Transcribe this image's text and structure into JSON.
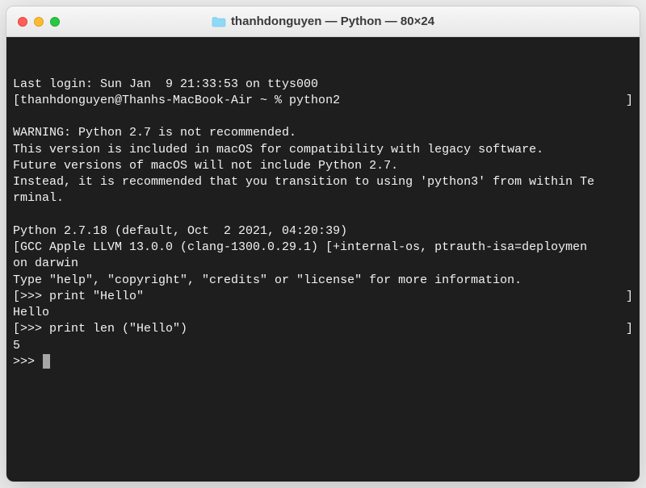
{
  "window": {
    "title": "thanhdonguyen — Python — 80×24"
  },
  "terminal": {
    "lines": [
      {
        "text": "Last login: Sun Jan  9 21:33:53 on ttys000",
        "rb": false
      },
      {
        "text": "[thanhdonguyen@Thanhs-MacBook-Air ~ % python2",
        "rb": true
      },
      {
        "text": "",
        "rb": false
      },
      {
        "text": "WARNING: Python 2.7 is not recommended.",
        "rb": false
      },
      {
        "text": "This version is included in macOS for compatibility with legacy software.",
        "rb": false
      },
      {
        "text": "Future versions of macOS will not include Python 2.7.",
        "rb": false
      },
      {
        "text": "Instead, it is recommended that you transition to using 'python3' from within Te",
        "rb": false
      },
      {
        "text": "rminal.",
        "rb": false
      },
      {
        "text": "",
        "rb": false
      },
      {
        "text": "Python 2.7.18 (default, Oct  2 2021, 04:20:39)",
        "rb": false
      },
      {
        "text": "[GCC Apple LLVM 13.0.0 (clang-1300.0.29.1) [+internal-os, ptrauth-isa=deploymen",
        "rb": false
      },
      {
        "text": "on darwin",
        "rb": false
      },
      {
        "text": "Type \"help\", \"copyright\", \"credits\" or \"license\" for more information.",
        "rb": false
      },
      {
        "text": "[>>> print \"Hello\"",
        "rb": true
      },
      {
        "text": "Hello",
        "rb": false
      },
      {
        "text": "[>>> print len (\"Hello\")",
        "rb": true
      },
      {
        "text": "5",
        "rb": false
      }
    ],
    "prompt": ">>> "
  }
}
